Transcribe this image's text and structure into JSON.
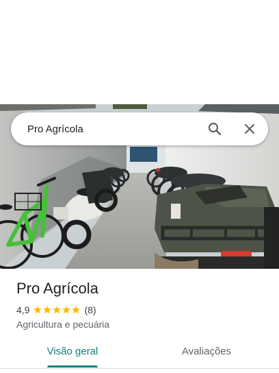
{
  "colors": {
    "accent": "#0f7d80",
    "star": "#fbbc04",
    "title_text": "#202124",
    "secondary_text": "#5f6368"
  },
  "search": {
    "query": "Pro Agrícola",
    "search_icon": "search-icon",
    "close_icon": "close-icon"
  },
  "place": {
    "name": "Pro Agrícola",
    "rating": "4,9",
    "rating_value": 4.9,
    "review_count": "(8)",
    "category": "Agricultura e pecuária"
  },
  "tabs": [
    {
      "label": "Visão geral",
      "active": true
    },
    {
      "label": "Avaliações",
      "active": false
    }
  ]
}
